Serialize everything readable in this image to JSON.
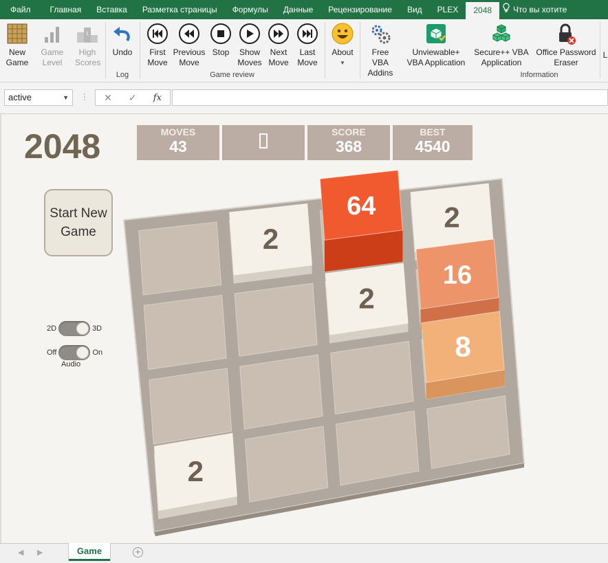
{
  "ribbon_tabs": [
    "Файл",
    "Главная",
    "Вставка",
    "Разметка страницы",
    "Формулы",
    "Данные",
    "Рецензирование",
    "Вид",
    "PLEX",
    "2048"
  ],
  "active_tab": "2048",
  "tell_me": "Что вы хотите",
  "ribbon": {
    "new_game": "New Game",
    "game_level": "Game Level",
    "high_scores": "High Scores",
    "undo": "Undo",
    "log_group": "Log",
    "first_move": "First Move",
    "previous_move": "Previous Move",
    "stop": "Stop",
    "show_moves": "Show Moves",
    "next_move": "Next Move",
    "last_move": "Last Move",
    "game_review_group": "Game review",
    "about": "About",
    "free_vba": "Free VBA Addins",
    "unviewable": "Unviewable+ VBA Application",
    "secure": "Secure++ VBA Application",
    "office_password": "Office Password Eraser",
    "information_group": "Information",
    "cut_off": "L"
  },
  "formula_bar": {
    "name_box": "active",
    "cancel_icon": "✕",
    "enter_icon": "✓",
    "fx_label": "fx",
    "formula": ""
  },
  "game": {
    "title": "2048",
    "moves_label": "MOVES",
    "moves": "43",
    "score_label": "SCORE",
    "score": "368",
    "best_label": "BEST",
    "best": "4540",
    "start_button": "Start New Game",
    "toggle_2d": "2D",
    "toggle_3d": "3D",
    "toggle_off": "Off",
    "toggle_on": "On",
    "audio_label": "Audio",
    "grid": [
      [
        "",
        "2",
        "64",
        "2"
      ],
      [
        "",
        "",
        "2",
        "16"
      ],
      [
        "",
        "",
        "",
        "8"
      ],
      [
        "2",
        "",
        "",
        ""
      ]
    ]
  },
  "sheet_tab": "Game",
  "colors": {
    "excel_green": "#217346",
    "score_box": "#bbada4",
    "tile_2": "#f5f0e8",
    "tile_8": "#f2b179",
    "tile_16": "#ee946a",
    "tile_64": "#f05a2e"
  }
}
